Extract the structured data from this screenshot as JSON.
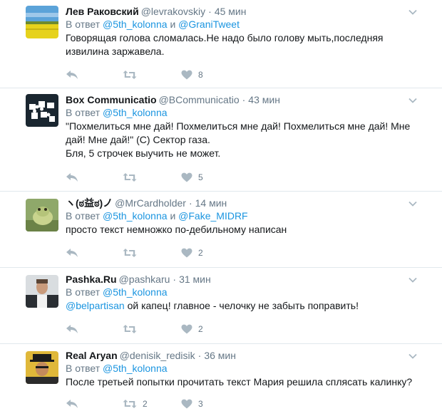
{
  "tweets": [
    {
      "name": "Лев Раковский",
      "handle": "@levrakovskiy",
      "time": "45 мин",
      "reply_prefix": "В ответ",
      "reply_mentions": [
        "@5th_kolonna",
        "@GraniTweet"
      ],
      "reply_joiner": "и",
      "text_lines": [
        "Говорящая голова сломалась.Не надо было голову мыть,последняя",
        "извилина заржавела."
      ],
      "retweets": "",
      "likes": "8",
      "avatar": "field-landscape"
    },
    {
      "name": "Box Communicatio",
      "handle": "@BCommunicatio",
      "time": "43 мин",
      "reply_prefix": "В ответ",
      "reply_mentions": [
        "@5th_kolonna"
      ],
      "reply_joiner": "",
      "text_lines": [
        "\"Похмелиться мне дай! Похмелиться мне дай! Похмелиться мне дай! Мне",
        "дай! Мне дай!\" (С) Сектор газа.",
        "Бля, 5 строчек выучить не может."
      ],
      "retweets": "",
      "likes": "5",
      "avatar": "puzzle-logo"
    },
    {
      "name": "ヽ(ಠ益ಠ)ノ",
      "handle": "@MrCardholder",
      "time": "14 мин",
      "reply_prefix": "В ответ",
      "reply_mentions": [
        "@5th_kolonna",
        "@Fake_MIDRF"
      ],
      "reply_joiner": "и",
      "text_lines": [
        "просто текст немножко по-дебильному написан"
      ],
      "retweets": "",
      "likes": "2",
      "avatar": "frog-photo"
    },
    {
      "name": "Pashka.Ru",
      "handle": "@pashkaru",
      "time": "31 мин",
      "reply_prefix": "В ответ",
      "reply_mentions": [
        "@5th_kolonna"
      ],
      "reply_joiner": "",
      "text_lines": [
        "@belpartisan ой капец! главное - челочку не забыть поправить!"
      ],
      "text_mention": "@belpartisan",
      "text_rest": " ой капец! главное - челочку не забыть поправить!",
      "retweets": "",
      "likes": "2",
      "avatar": "man-photo"
    },
    {
      "name": "Real Aryan",
      "handle": "@denisik_redisik",
      "time": "36 мин",
      "reply_prefix": "В ответ",
      "reply_mentions": [
        "@5th_kolonna"
      ],
      "reply_joiner": "",
      "text_lines": [
        "После третьей попытки прочитать текст Мария решила сплясать калинку?"
      ],
      "retweets": "2",
      "likes": "3",
      "avatar": "man-cap-photo"
    }
  ],
  "colors": {
    "link": "#1b95e0",
    "muted": "#657786",
    "icon": "#aab8c2",
    "divider": "#e1e8ed"
  }
}
